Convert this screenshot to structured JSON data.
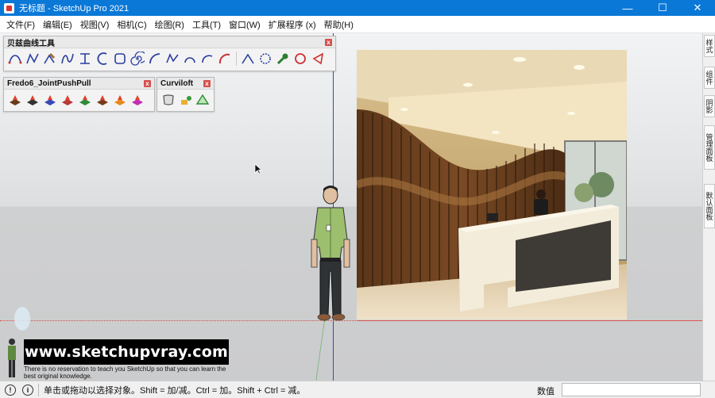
{
  "window": {
    "title": "无标题 - SketchUp Pro 2021",
    "controls": [
      "—",
      "☐",
      "✕"
    ]
  },
  "menu": [
    "文件(F)",
    "编辑(E)",
    "视图(V)",
    "相机(C)",
    "绘图(R)",
    "工具(T)",
    "窗口(W)",
    "扩展程序 (x)",
    "帮助(H)"
  ],
  "toolbars": {
    "bezier": {
      "title": "贝兹曲线工具",
      "close": "x",
      "tools": [
        "bezier-curve-icon",
        "polyline-curve-icon",
        "edit-curve-icon",
        "spline-icon",
        "s-curve-icon",
        "arc-curve-icon",
        "rounded-rect-icon",
        "spiral-icon",
        "arc-icon",
        "zigzag-icon",
        "half-arc-icon",
        "curve-segment-icon",
        "red-arc-icon",
        "line-curve-icon",
        "circle-dots-icon",
        "wrench-icon",
        "red-circle-icon",
        "red-triangle-icon"
      ]
    },
    "joint_push_pull": {
      "title": "Fredo6_JointPushPull",
      "close": "x",
      "tools": [
        "joint-push-pull-icon",
        "vector-push-pull-icon",
        "normal-push-pull-icon",
        "extrude-push-pull-icon",
        "follow-push-pull-icon",
        "undo-push-pull-icon",
        "repeat-push-pull-icon",
        "finish-push-pull-icon"
      ]
    },
    "curviloft": {
      "title": "Curviloft",
      "close": "x",
      "tools": [
        "loft-by-spline-icon",
        "skin-contours-icon",
        "loft-along-path-icon"
      ]
    }
  },
  "tray": {
    "tabs": [
      "样式",
      "组件",
      "阴影",
      "管理面板",
      "默认面板"
    ]
  },
  "status": {
    "message": "单击或拖动以选择对象。Shift = 加/减。Ctrl = 加。Shift + Ctrl = 减。",
    "measurements_label": "数值",
    "measurements_value": ""
  },
  "watermark": {
    "banner": "www.sketchupvray.com",
    "caption": "There is no reservation to teach you SketchUp so that you can learn the best original knowledge."
  },
  "colors": {
    "titlebar": "#0a78d7",
    "axis_blue": "#2f47d6",
    "axis_red": "#d14a4a",
    "axis_green": "#3ba24b"
  }
}
